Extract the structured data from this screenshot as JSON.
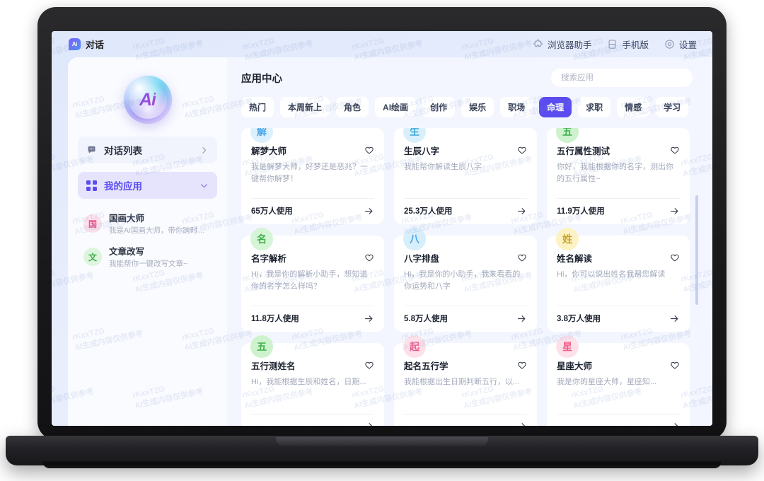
{
  "topbar": {
    "brand_mark": "Ai",
    "brand_label": "对话",
    "actions": [
      {
        "icon": "puzzle-icon",
        "label": "浏览器助手"
      },
      {
        "icon": "mobile-icon",
        "label": "手机版"
      },
      {
        "icon": "gear-icon",
        "label": "设置"
      }
    ]
  },
  "sidebar": {
    "logo_text": "Ai",
    "nav": [
      {
        "icon": "chat-list-icon",
        "label": "对话列表",
        "chevron": "chevron-right",
        "active": false
      },
      {
        "icon": "grid-icon",
        "label": "我的应用",
        "chevron": "chevron-down",
        "active": true
      }
    ],
    "apps": [
      {
        "avatar": "国",
        "avatar_bg": "#fde1ec",
        "avatar_color": "#e8548c",
        "title": "国画大师",
        "desc": "我是AI国画大师，带你跨时代体..."
      },
      {
        "avatar": "文",
        "avatar_bg": "#ddf5dd",
        "avatar_color": "#3fa84a",
        "title": "文章改写",
        "desc": "我能帮你一键改写文章~"
      }
    ]
  },
  "main": {
    "title": "应用中心",
    "search": {
      "value": "",
      "placeholder": "搜索应用"
    },
    "tabs": [
      {
        "label": "热门",
        "active": false
      },
      {
        "label": "本周新上",
        "active": false
      },
      {
        "label": "角色",
        "active": false
      },
      {
        "label": "AI绘画",
        "active": false
      },
      {
        "label": "创作",
        "active": false
      },
      {
        "label": "娱乐",
        "active": false
      },
      {
        "label": "职场",
        "active": false
      },
      {
        "label": "命理",
        "active": true
      },
      {
        "label": "求职",
        "active": false
      },
      {
        "label": "情感",
        "active": false
      },
      {
        "label": "学习",
        "active": false
      }
    ],
    "cards": [
      {
        "badge": "解",
        "badge_bg": "#ddf0fd",
        "badge_color": "#4aa7e8",
        "title": "解梦大师",
        "desc": "我是解梦大师，好梦还是恶兆？一键帮你解梦！",
        "count": "65万人使用"
      },
      {
        "badge": "生",
        "badge_bg": "#d9f0fb",
        "badge_color": "#3fa9d8",
        "title": "生辰八字",
        "desc": "我能帮你解读生辰八字",
        "count": "25.3万人使用"
      },
      {
        "badge": "五",
        "badge_bg": "#cdf2cd",
        "badge_color": "#3fb04a",
        "title": "五行属性测试",
        "desc": "你好，我能根据你的名字，测出你的五行属性~",
        "count": "11.9万人使用"
      },
      {
        "badge": "名",
        "badge_bg": "#d6f4d6",
        "badge_color": "#3fb04a",
        "title": "名字解析",
        "desc": "Hi，我是你的解析小助手，想知道你的名字怎么样吗？",
        "count": "11.8万人使用"
      },
      {
        "badge": "八",
        "badge_bg": "#d7eefb",
        "badge_color": "#4aa7e8",
        "title": "八字排盘",
        "desc": "Hi，我是你的小助手，我来看看的你运势和八字",
        "count": "5.8万人使用"
      },
      {
        "badge": "姓",
        "badge_bg": "#fdf2c4",
        "badge_color": "#c9a227",
        "title": "姓名解读",
        "desc": "Hi，你可以说出姓名我帮您解读",
        "count": "3.8万人使用"
      },
      {
        "badge": "五",
        "badge_bg": "#cdf2cd",
        "badge_color": "#3fb04a",
        "title": "五行测姓名",
        "desc": "Hi，我能根据生辰和姓名，日期...",
        "count": ""
      },
      {
        "badge": "起",
        "badge_bg": "#fde1ea",
        "badge_color": "#ef5f8c",
        "title": "起名五行学",
        "desc": "我能根据出生日期判断五行，以...",
        "count": ""
      },
      {
        "badge": "星",
        "badge_bg": "#fde1ea",
        "badge_color": "#ef5f8c",
        "title": "星座大师",
        "desc": "我是你的星座大师，星座知...",
        "count": ""
      }
    ]
  },
  "watermark": {
    "line1": "rKxxTZG",
    "line2": "AI生成内容仅供参考"
  },
  "colors": {
    "accent": "#5b4cf0",
    "accent_soft": "#e6e4fd",
    "screen_bg": "#e8eefc",
    "panel_bg": "#f3f6fe",
    "sidebar_bg": "#fafbff"
  }
}
